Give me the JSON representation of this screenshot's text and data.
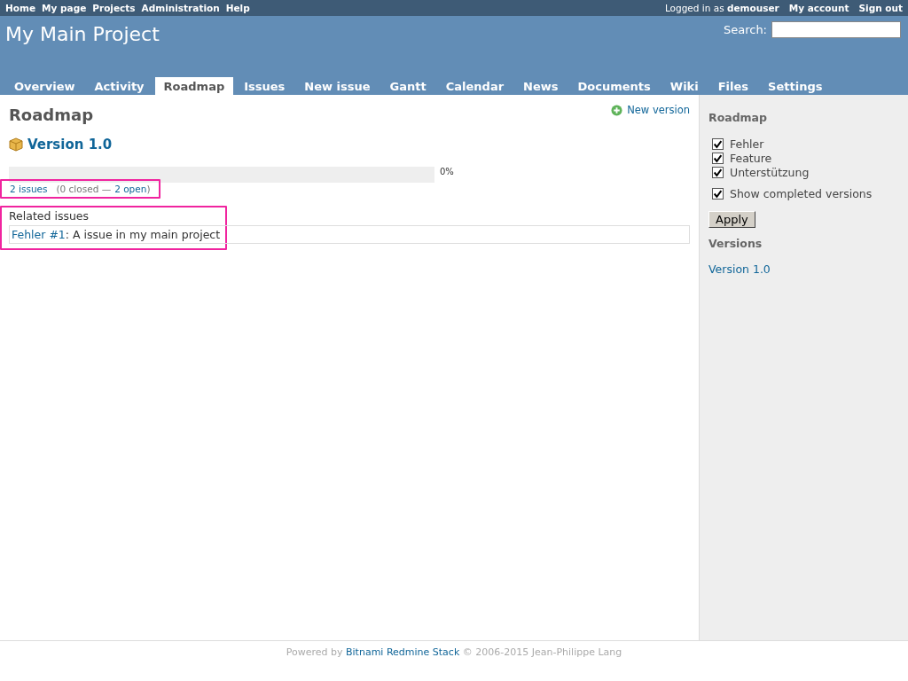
{
  "top_menu": {
    "left": [
      "Home",
      "My page",
      "Projects",
      "Administration",
      "Help"
    ],
    "logged_in_prefix": "Logged in as",
    "user": "demouser",
    "right": [
      "My account",
      "Sign out"
    ]
  },
  "header": {
    "title": "My Main Project",
    "search_label": "Search:"
  },
  "tabs": [
    {
      "label": "Overview",
      "selected": false
    },
    {
      "label": "Activity",
      "selected": false
    },
    {
      "label": "Roadmap",
      "selected": true
    },
    {
      "label": "Issues",
      "selected": false
    },
    {
      "label": "New issue",
      "selected": false
    },
    {
      "label": "Gantt",
      "selected": false
    },
    {
      "label": "Calendar",
      "selected": false
    },
    {
      "label": "News",
      "selected": false
    },
    {
      "label": "Documents",
      "selected": false
    },
    {
      "label": "Wiki",
      "selected": false
    },
    {
      "label": "Files",
      "selected": false
    },
    {
      "label": "Settings",
      "selected": false
    }
  ],
  "content": {
    "title": "Roadmap",
    "new_version": "New version",
    "version": {
      "name": "Version 1.0",
      "progress": {
        "level": 0,
        "reading": "0%"
      },
      "issues_link": "2 issues",
      "closed_text": "(0 closed —",
      "open_link": "2 open",
      "close_paren": ")",
      "related_title": "Related issues",
      "related": [
        {
          "tracker_link": "Fehler #1",
          "subject": ": A issue in my main project"
        }
      ]
    }
  },
  "sidebar": {
    "title": "Roadmap",
    "trackers": [
      {
        "label": "Fehler",
        "checked": true
      },
      {
        "label": "Feature",
        "checked": true
      },
      {
        "label": "Unterstützung",
        "checked": true
      }
    ],
    "completed": {
      "label": "Show completed versions",
      "checked": true
    },
    "apply": "Apply",
    "versions_title": "Versions",
    "versions": [
      "Version 1.0"
    ]
  },
  "footer": {
    "prefix": "Powered by",
    "link": "Bitnami Redmine Stack",
    "suffix": "© 2006-2015 Jean-Philippe Lang"
  }
}
